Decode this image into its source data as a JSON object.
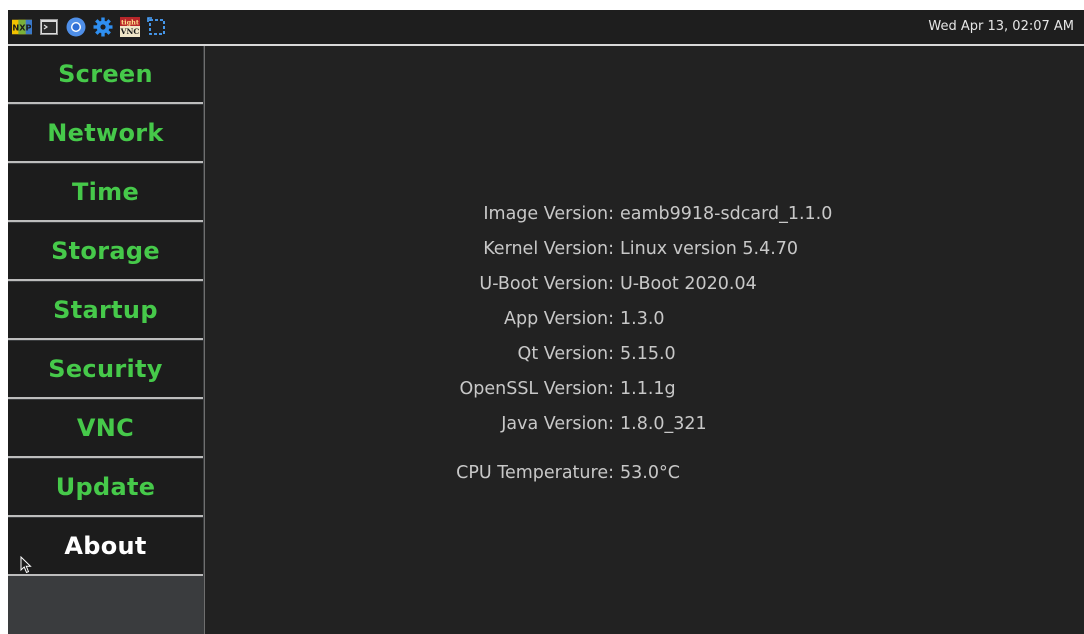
{
  "taskbar": {
    "icons": [
      "nxp-logo-icon",
      "terminal-icon",
      "chromium-icon",
      "settings-gear-icon",
      "tightvnc-icon",
      "screenshot-selection-icon"
    ],
    "nxp_label": "NXP",
    "vnc_label_top": "tight",
    "vnc_label_bottom": "VNC",
    "clock": "Wed Apr 13, 02:07 AM"
  },
  "sidebar": {
    "items": [
      {
        "label": "Screen"
      },
      {
        "label": "Network"
      },
      {
        "label": "Time"
      },
      {
        "label": "Storage"
      },
      {
        "label": "Startup"
      },
      {
        "label": "Security"
      },
      {
        "label": "VNC"
      },
      {
        "label": "Update"
      },
      {
        "label": "About"
      }
    ],
    "active": "About"
  },
  "about": {
    "rows": [
      {
        "label": "Image Version:",
        "value": "eamb9918-sdcard_1.1.0"
      },
      {
        "label": "Kernel Version:",
        "value": "Linux version 5.4.70"
      },
      {
        "label": "U-Boot Version:",
        "value": "U-Boot 2020.04"
      },
      {
        "label": "App Version:",
        "value": "1.3.0"
      },
      {
        "label": "Qt Version:",
        "value": "5.15.0"
      },
      {
        "label": "OpenSSL Version:",
        "value": "1.1.1g"
      },
      {
        "label": "Java Version:",
        "value": "1.8.0_321"
      },
      {
        "label": "CPU Temperature:",
        "value": "53.0°C"
      }
    ]
  },
  "colors": {
    "nav_text": "#46c94a",
    "nav_active_text": "#ffffff",
    "background": "#222222"
  }
}
